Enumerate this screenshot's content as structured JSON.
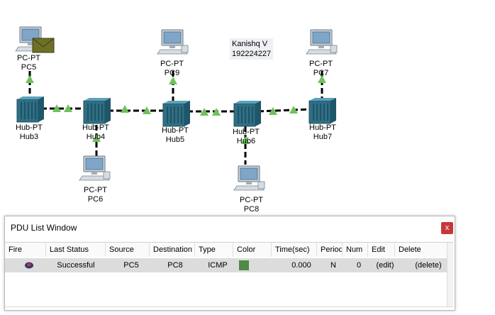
{
  "annotation": {
    "name": "Kanishq V",
    "id": "192224227"
  },
  "devices": {
    "pc5": {
      "type": "PC-PT",
      "name": "PC5"
    },
    "pc9": {
      "type": "PC-PT",
      "name": "PC9"
    },
    "pc7": {
      "type": "PC-PT",
      "name": "PC7"
    },
    "pc6": {
      "type": "PC-PT",
      "name": "PC6"
    },
    "pc8": {
      "type": "PC-PT",
      "name": "PC8"
    },
    "hub3": {
      "type": "Hub-PT",
      "name": "Hub3"
    },
    "hub4": {
      "type": "Hub-PT",
      "name": "Hub4"
    },
    "hub5": {
      "type": "Hub-PT",
      "name": "Hub5"
    },
    "hub6": {
      "type": "Hub-PT",
      "name": "Hub6"
    },
    "hub7": {
      "type": "Hub-PT",
      "name": "Hub7"
    }
  },
  "colors": {
    "link": "#000000",
    "link_up": "#6ec25a",
    "pdu_green": "#4f8a47",
    "close_red": "#c8373b"
  },
  "pdu_window": {
    "title": "PDU List Window",
    "close_label": "x",
    "columns": [
      "Fire",
      "Last Status",
      "Source",
      "Destination",
      "Type",
      "Color",
      "Time(sec)",
      "Periodic",
      "Num",
      "Edit",
      "Delete"
    ],
    "rows": [
      {
        "last_status": "Successful",
        "source": "PC5",
        "destination": "PC8",
        "type": "ICMP",
        "color": "#4f8a47",
        "time": "0.000",
        "periodic": "N",
        "num": "0",
        "edit": "(edit)",
        "delete": "(delete)"
      }
    ]
  }
}
